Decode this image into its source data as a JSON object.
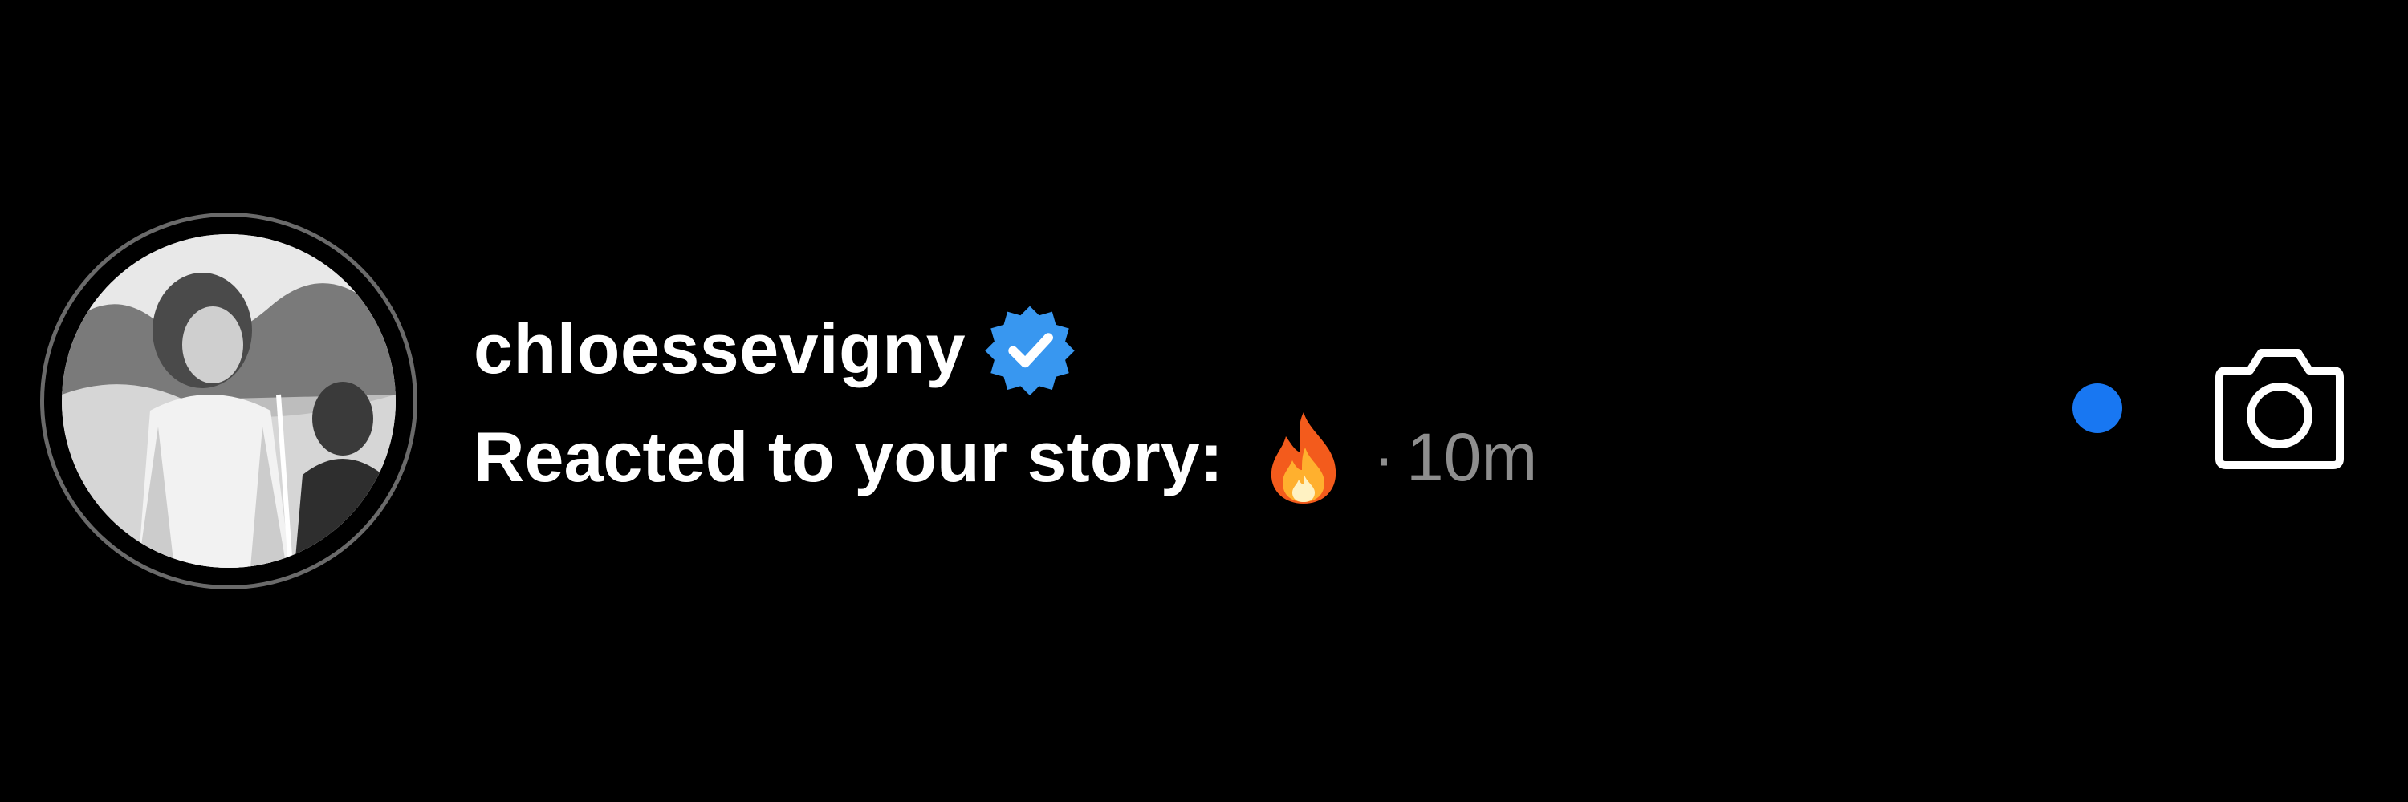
{
  "notification": {
    "username": "chloessevigny",
    "message": "Reacted to your story:",
    "separator": "·",
    "time": "10m",
    "reaction_icon": "fire-emoji",
    "verified_icon": "verified-badge-icon",
    "unread": true
  },
  "actions": {
    "camera_icon": "camera-icon"
  },
  "colors": {
    "background": "#000000",
    "text_primary": "#ffffff",
    "text_secondary": "#8e8e8e",
    "unread_dot": "#1877f2",
    "verified_badge": "#3897f0",
    "avatar_ring": "#6a6a6a"
  }
}
